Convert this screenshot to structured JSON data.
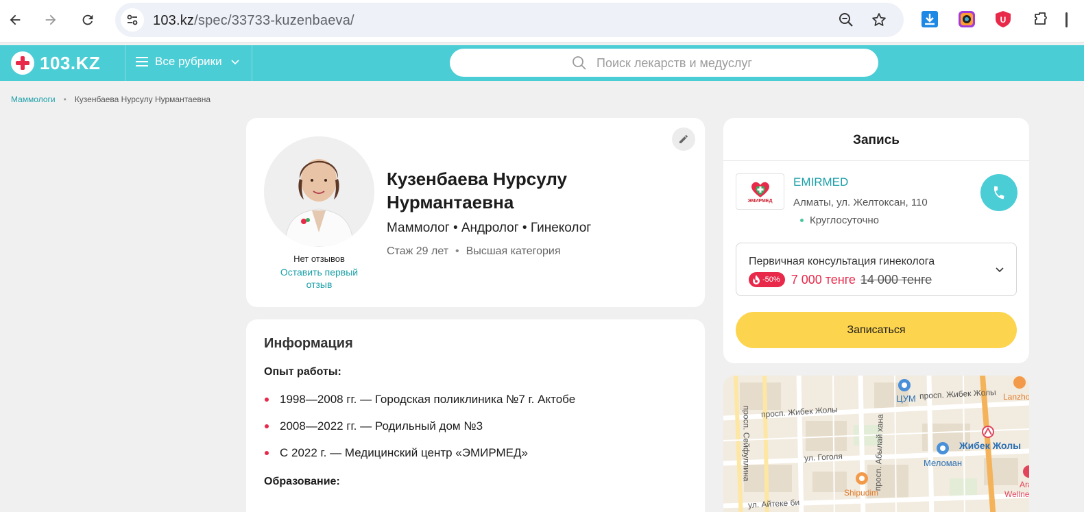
{
  "browser": {
    "url_host": "103.kz",
    "url_path": "/spec/33733-kuzenbaeva/"
  },
  "site": {
    "logo_text": "103.KZ",
    "rubrics_label": "Все рубрики",
    "search_placeholder": "Поиск лекарств и медуслуг",
    "accent_color": "#4bcdd6"
  },
  "breadcrumb": {
    "parent": "Маммологи",
    "separator": "•",
    "current": "Кузенбаева Нурсулу Нурмантаевна"
  },
  "profile": {
    "name": "Кузенбаева Нурсулу Нурмантаевна",
    "specialties": "Маммолог • Андролог • Гинеколог",
    "experience": "Стаж 29 лет",
    "meta_separator": "•",
    "category": "Высшая категория",
    "reviews_none": "Нет отзывов",
    "reviews_link": "Оставить первый отзыв"
  },
  "info": {
    "title": "Информация",
    "experience_heading": "Опыт работы:",
    "experience_items": [
      "1998—2008 гг. — Городская поликлиника №7 г. Актобе",
      "2008—2022 гг. — Родильный дом №3",
      "С 2022 г. — Медицинский центр «ЭМИРМЕД»"
    ],
    "education_heading": "Образование:"
  },
  "booking": {
    "title": "Запись",
    "clinic_name": "EMIRMED",
    "clinic_logo_label": "ЭМИРМЕД",
    "clinic_address": "Алматы, ул. Желтоксан, 110",
    "clinic_hours": "Круглосуточно",
    "service_name": "Первичная консультация гинеколога",
    "discount": "-50%",
    "price_new": "7 000 тенге",
    "price_old": "14 000 тенге",
    "book_button": "Записаться"
  },
  "map": {
    "labels": {
      "street1": "просп. Жибек Жолы",
      "street2": "просп. Жибек Жолы",
      "street3": "просп. Сейфуллина",
      "street4": "ул. Гоголя",
      "street5": "просп. Абылай хана",
      "street6": "ул. Айтеке би",
      "poi1": "ЦУМ",
      "poi2": "Меломан",
      "poi3": "Shipudim",
      "poi4": "Lanzho",
      "poi5": "Ara",
      "poi6": "Wellne",
      "metro": "Жибек Жолы"
    }
  }
}
